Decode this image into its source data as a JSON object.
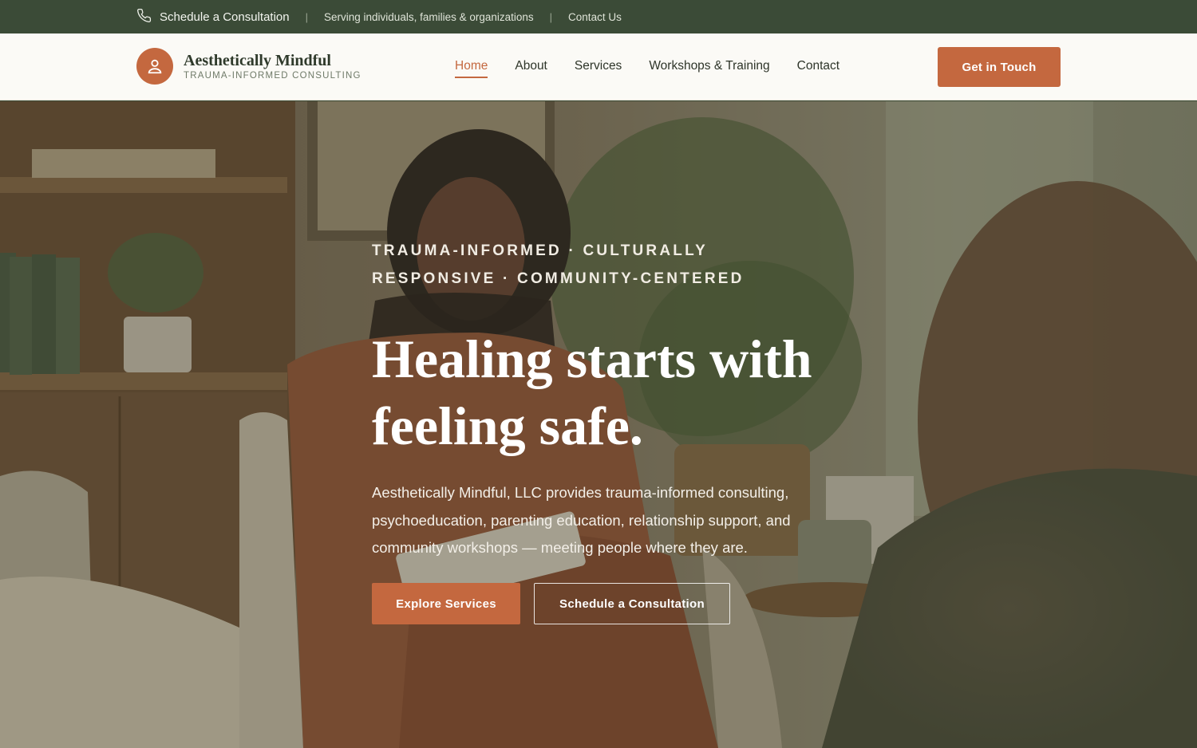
{
  "topbar": {
    "phone_icon": "phone-icon",
    "schedule_label": "Schedule a Consultation",
    "separator": "|",
    "serving_text": "Serving individuals, families & organizations",
    "contact_label": "Contact Us"
  },
  "header": {
    "brand_name": "Aesthetically Mindful",
    "brand_tagline": "TRAUMA-INFORMED CONSULTING",
    "logo_icon": "person-icon",
    "nav": [
      {
        "label": "Home",
        "active": true
      },
      {
        "label": "About"
      },
      {
        "label": "Services"
      },
      {
        "label": "Workshops & Training"
      },
      {
        "label": "Contact"
      }
    ],
    "cta_label": "Get in Touch"
  },
  "hero": {
    "eyebrow": "TRAUMA-INFORMED · CULTURALLY RESPONSIVE · COMMUNITY-CENTERED",
    "headline": "Healing starts with feeling safe.",
    "lede": "Aesthetically Mindful, LLC provides trauma-informed consulting, psychoeducation, parenting education, relationship support, and community workshops — meeting people where they are.",
    "primary_button": "Explore Services",
    "secondary_button": "Schedule a Consultation"
  },
  "colors": {
    "topbar_bg": "#3b4b37",
    "accent": "#c4683f",
    "header_bg": "#fbfaf6",
    "text_dark": "#2e3529"
  }
}
